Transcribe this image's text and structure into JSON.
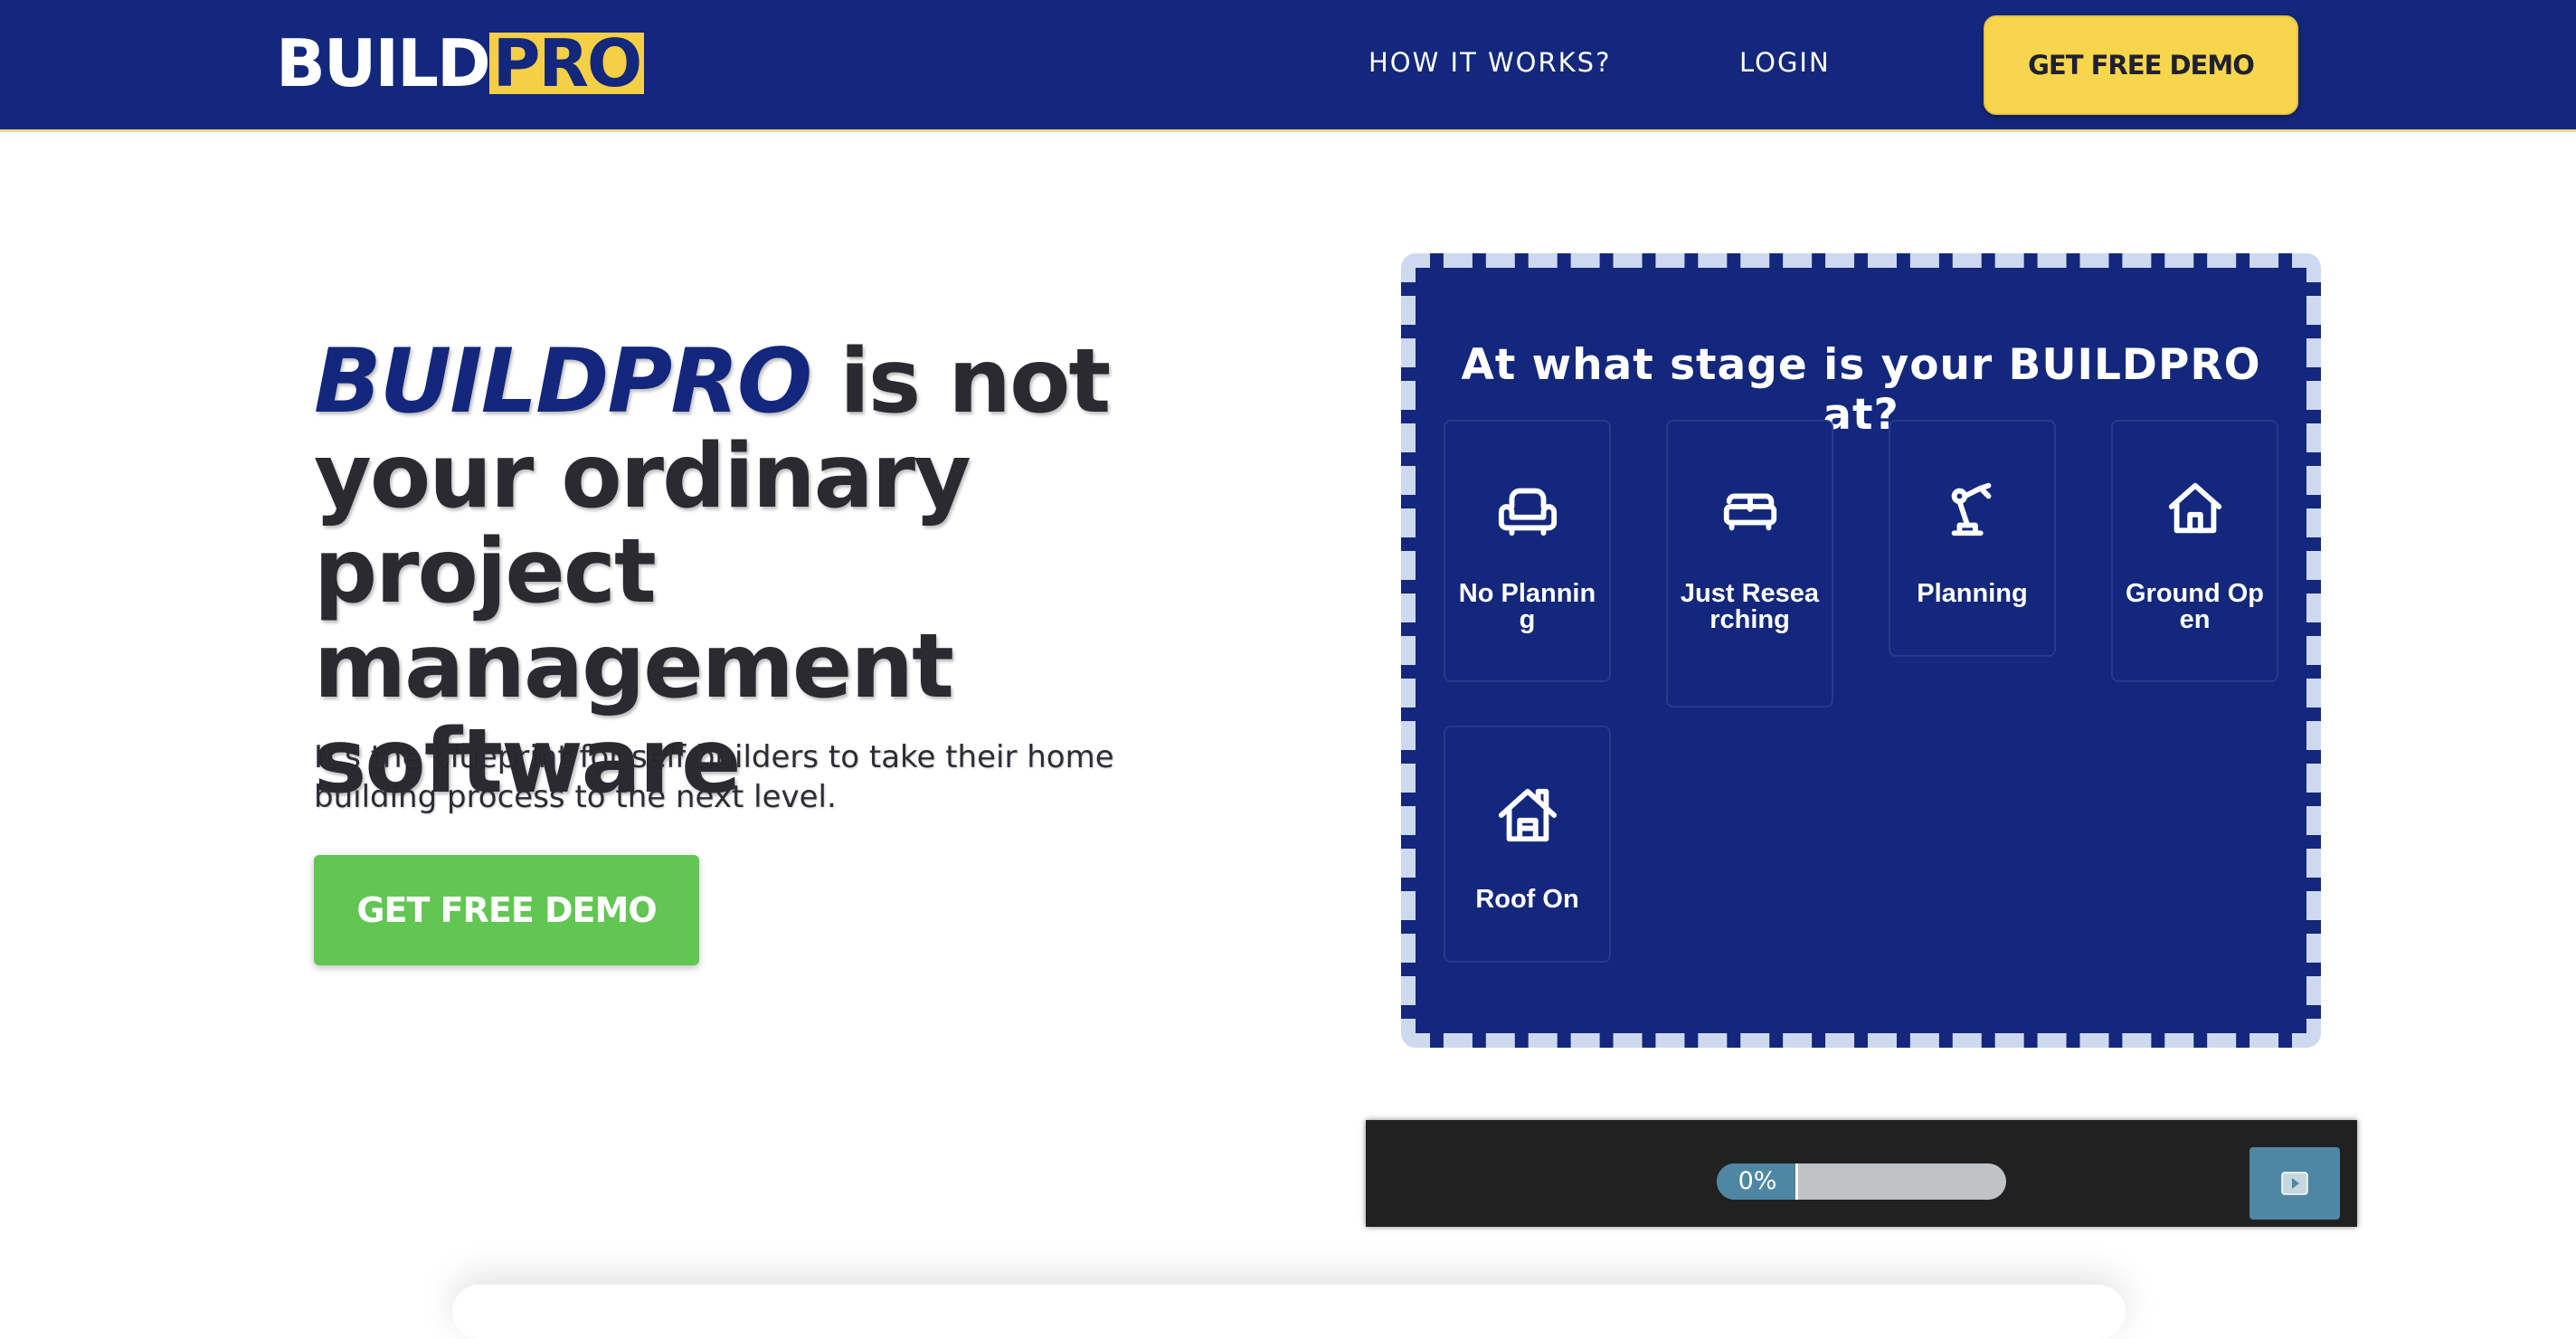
{
  "nav": {
    "logo_part1": "BUILD",
    "logo_part2": "PRO",
    "links": [
      "HOW IT WORKS?",
      "LOGIN"
    ],
    "cta_label": "GET FREE DEMO"
  },
  "hero": {
    "title_brand": "BUILDPRO",
    "title_rest": " is not your ordinary project management software",
    "subtitle": "It’s the blueprint for self builders to take their home building process to the next level.",
    "cta_label": "GET FREE DEMO"
  },
  "quiz": {
    "question": "At what stage is your BUILDPRO at?",
    "options": [
      {
        "label": "No Planning",
        "icon": "armchair-icon"
      },
      {
        "label": "Just Researching",
        "icon": "sofa-icon"
      },
      {
        "label": "Planning",
        "icon": "robot-arm-icon"
      },
      {
        "label": "Ground Open",
        "icon": "house-icon"
      },
      {
        "label": "Roof On",
        "icon": "house-roof-icon"
      }
    ]
  },
  "player": {
    "progress_label": "0%",
    "progress_value": 0,
    "play_icon": "play-icon"
  },
  "colors": {
    "brand_navy": "#13277c",
    "brand_yellow": "#f7d54c",
    "cta_green": "#62c653",
    "player_blue": "#4d87a3"
  }
}
